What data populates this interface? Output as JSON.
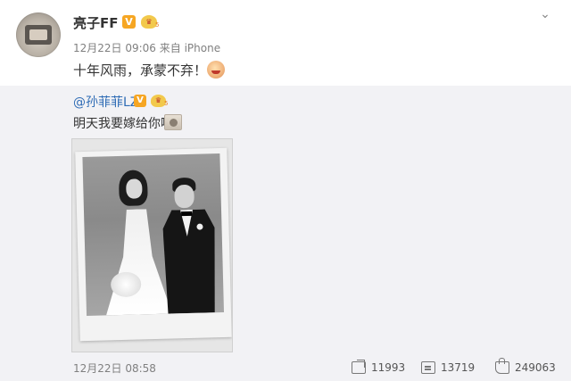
{
  "post": {
    "author": "亮子FF",
    "verified_badge": "V",
    "level_badge": "5",
    "meta": "12月22日 09:06 来自 iPhone",
    "text": "十年风雨，承蒙不弃！",
    "emoji_icon": "smiley-emoji-icon",
    "menu_icon": "chevron-down-icon"
  },
  "repost": {
    "author": "@孙菲菲LZ",
    "verified_badge": "V",
    "level_badge": "5",
    "text": "明天我要嫁给你啦",
    "emoji_icon": "face-emoji-icon",
    "image_icon": "wedding-photo"
  },
  "footer": {
    "time": "12月22日 08:58",
    "share_count": "11993",
    "comment_count": "13719",
    "like_count": "249063",
    "share_icon": "share-icon",
    "comment_icon": "comment-icon",
    "like_icon": "thumbs-up-icon"
  },
  "colors": {
    "link": "#2f6cb5",
    "repost_bg": "#f2f2f5",
    "badge": "#f6a623",
    "muted": "#808080"
  }
}
